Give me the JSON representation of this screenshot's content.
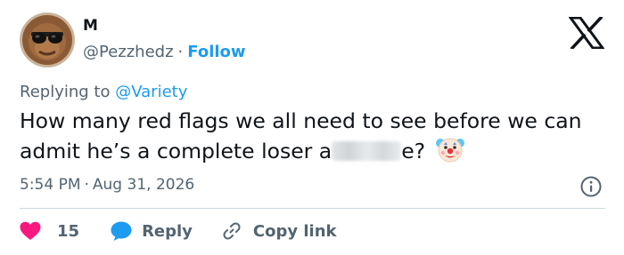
{
  "author": {
    "name": "M",
    "handle": "@Pezzhedz",
    "separator": "·",
    "follow_label": "Follow",
    "avatar_icon": "bigfoot-sunglasses-avatar"
  },
  "header": {
    "logo_icon": "x-logo"
  },
  "replying": {
    "prefix": "Replying to",
    "mention": "@Variety"
  },
  "tweet": {
    "text_before_redaction": "How many red flags we all need to see before we can admit he’s a complete loser a",
    "text_after_redaction": "e?",
    "emoji_icon": "clown-face-icon"
  },
  "meta": {
    "time": "5:54 PM",
    "separator": "·",
    "date": "Aug 31, 2026",
    "info_icon": "info-icon"
  },
  "actions": {
    "like_count": "15",
    "reply_label": "Reply",
    "copy_label": "Copy link"
  },
  "colors": {
    "accent": "#1d9bf0",
    "like": "#f91880",
    "muted_text": "#536471",
    "primary_text": "#0f1419",
    "divider": "#cfd9de"
  }
}
